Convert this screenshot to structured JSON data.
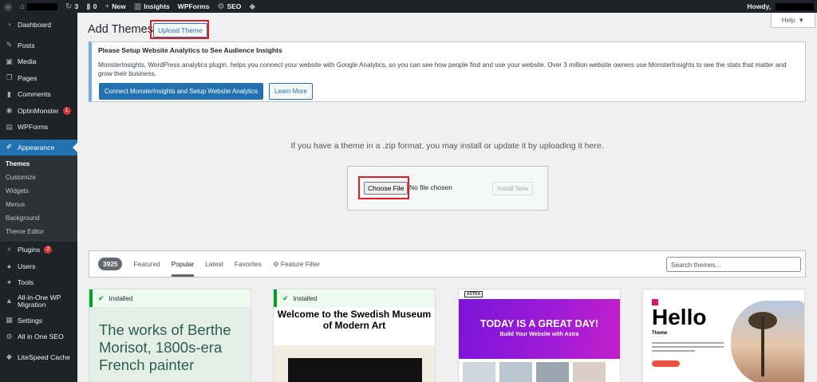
{
  "adminbar": {
    "updates_count": "3",
    "comments_count": "0",
    "new_label": "New",
    "insights_label": "Insights",
    "wpforms_label": "WPForms",
    "seo_label": "SEO",
    "howdy_label": "Howdy,"
  },
  "sidebar": {
    "dashboard": "Dashboard",
    "posts": "Posts",
    "media": "Media",
    "pages": "Pages",
    "comments": "Comments",
    "optinmonster": "OptinMonster",
    "optinmonster_badge": "1",
    "wpforms": "WPForms",
    "appearance": "Appearance",
    "submenu": {
      "themes": "Themes",
      "customize": "Customize",
      "widgets": "Widgets",
      "menus": "Menus",
      "background": "Background",
      "theme_editor": "Theme Editor"
    },
    "plugins": "Plugins",
    "plugins_badge": "2",
    "users": "Users",
    "tools": "Tools",
    "all_in_one_migration_1": "All-in-One WP",
    "all_in_one_migration_2": "Migration",
    "settings": "Settings",
    "all_in_one_seo": "All in One SEO",
    "litespeed": "LiteSpeed Cache"
  },
  "header": {
    "title": "Add Themes",
    "upload_theme": "Upload Theme",
    "help": "Help"
  },
  "notice": {
    "title": "Please Setup Website Analytics to See Audience Insights",
    "body": "MonsterInsights, WordPress analytics plugin, helps you connect your website with Google Analytics, so you can see how people find and use your website. Over 3 million website owners use MonsterInsights to see the stats that matter and grow their business.",
    "connect_button": "Connect MonsterInsights and Setup Website Analytics",
    "learn_more": "Learn More"
  },
  "upload": {
    "instructions": "If you have a theme in a .zip format, you may install or update it by uploading it here.",
    "choose_file": "Choose File",
    "no_file": "No file chosen",
    "install_now": "Install Now"
  },
  "filters": {
    "count": "3925",
    "featured": "Featured",
    "popular": "Popular",
    "latest": "Latest",
    "favorites": "Favorites",
    "feature_filter": "Feature Filter",
    "search_placeholder": "Search themes..."
  },
  "themes": {
    "installed_label": "Installed",
    "t1_text": "The works of Berthe Morisot, 1800s-era French painter",
    "t2_heading": "Welcome to the Swedish Museum of Modern Art",
    "t3_logo": "ASTRA",
    "t3_headline": "TODAY IS A GREAT DAY!",
    "t3_subline": "Build Your Website with Astra",
    "t4_hello": "Hello",
    "t4_sub": "Theme"
  }
}
